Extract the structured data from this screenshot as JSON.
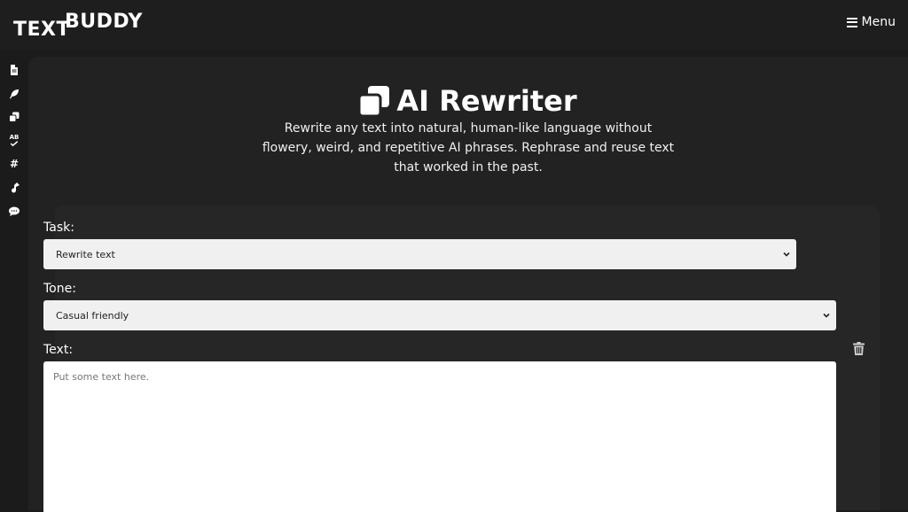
{
  "brand": {
    "logo_word1": "TEXT",
    "logo_word2": "BUDDY"
  },
  "header": {
    "menu_label": "Menu"
  },
  "sidebar": {
    "items": [
      {
        "icon": "document-icon"
      },
      {
        "icon": "feather-icon"
      },
      {
        "icon": "copy-icon"
      },
      {
        "icon": "spellcheck-icon",
        "text": "AB"
      },
      {
        "icon": "hashtag-icon",
        "text": "#"
      },
      {
        "icon": "music-icon"
      },
      {
        "icon": "chat-icon"
      }
    ]
  },
  "hero": {
    "title": "AI Rewriter",
    "description": "Rewrite any text into natural, human-like language without flowery, weird, and repetitive AI phrases. Rephrase and reuse text that worked in the past."
  },
  "form": {
    "task_label": "Task:",
    "task_value": "Rewrite text",
    "tone_label": "Tone:",
    "tone_value": "Casual friendly",
    "text_label": "Text:",
    "text_placeholder": "Put some text here."
  },
  "colors": {
    "background": "#1b1b1b",
    "panel": "#222222",
    "card": "#262626",
    "select_bg": "#f0f0f0"
  }
}
